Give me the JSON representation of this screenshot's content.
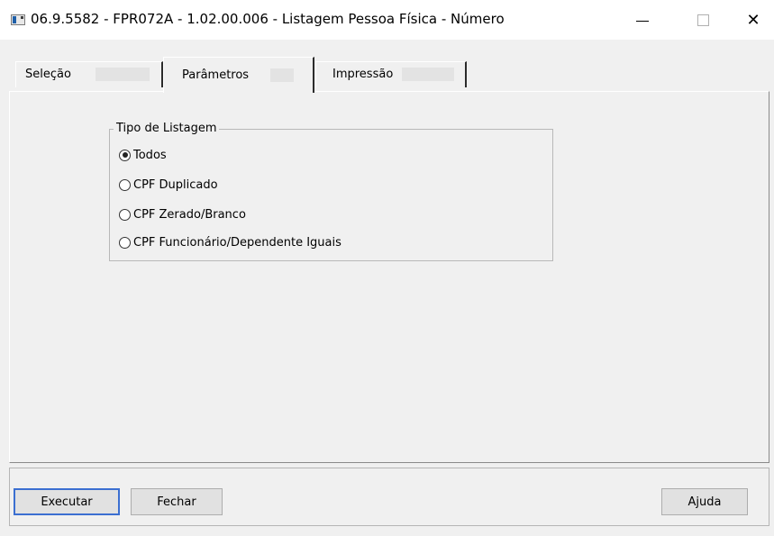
{
  "window": {
    "title": "06.9.5582 - FPR072A - 1.02.00.006 - Listagem Pessoa Física - Número",
    "close_glyph": "✕"
  },
  "tabs": [
    {
      "label": "Seleção",
      "selected": false
    },
    {
      "label": "Parâmetros",
      "selected": true
    },
    {
      "label": "Impressão",
      "selected": false
    }
  ],
  "group": {
    "legend": "Tipo de Listagem",
    "options": [
      {
        "label": "Todos",
        "checked": true
      },
      {
        "label": "CPF Duplicado",
        "checked": false
      },
      {
        "label": "CPF Zerado/Branco",
        "checked": false
      },
      {
        "label": "CPF Funcionário/Dependente Iguais",
        "checked": false
      }
    ]
  },
  "buttons": {
    "executar": "Executar",
    "fechar": "Fechar",
    "ajuda": "Ajuda"
  },
  "colors": {
    "background": "#f0f0f0",
    "focus_border": "#3b6fd1"
  }
}
